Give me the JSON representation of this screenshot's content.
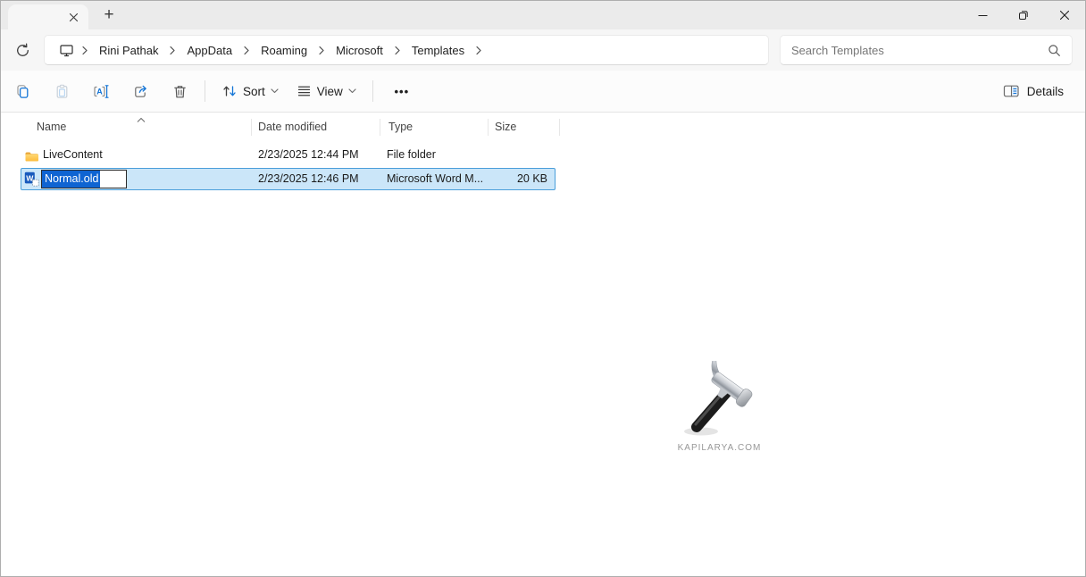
{
  "icons": {
    "tab-close": "✕",
    "new-tab": "+",
    "minimize-window": "—",
    "restore-window": "❐",
    "close-window": "✕",
    "refresh": "circular-arrow",
    "device": "monitor",
    "breadcrumb-chevron": "›",
    "search": "magnifier",
    "copy": "two-overlapping-squares",
    "paste": "clipboard",
    "rename": "A-with-text-cursor",
    "share": "box-with-arrow-out",
    "delete": "trash-can",
    "sort": "up-down-arrows",
    "view": "horizontal-lines",
    "more": "•••",
    "details": "split-pane",
    "folder": "yellow-folder",
    "word-macro-template": "blue-W-document",
    "sort-ascending": "^"
  },
  "navbar": {
    "breadcrumb": {
      "separator": "›",
      "items": [
        "Rini Pathak",
        "AppData",
        "Roaming",
        "Microsoft",
        "Templates"
      ]
    },
    "search": {
      "placeholder": "Search Templates"
    }
  },
  "toolbar": {
    "sort_label": "Sort",
    "view_label": "View",
    "more_glyph": "•••",
    "details_label": "Details"
  },
  "file_list": {
    "columns": {
      "name": "Name",
      "date_modified": "Date modified",
      "type": "Type",
      "size": "Size"
    },
    "sort": {
      "column": "Name",
      "direction": "ascending"
    },
    "rows": [
      {
        "name": "LiveContent",
        "date_modified": "2/23/2025 12:44 PM",
        "type": "File folder",
        "size": ""
      },
      {
        "name": "Normal.old",
        "date_modified": "2/23/2025 12:46 PM",
        "type": "Microsoft Word M...",
        "size": "20 KB",
        "selected": true,
        "renaming": true,
        "rename_value": "Normal.old"
      }
    ]
  },
  "watermark": {
    "text": "KAPILARYA.COM"
  },
  "colors": {
    "accent_blue": "#1374d6",
    "selection_bg": "#cbe6f9",
    "selection_border": "#4a9eda",
    "text_selection_bg": "#0f64d2",
    "folder_yellow": "#ffc24a",
    "word_blue": "#185abd"
  }
}
